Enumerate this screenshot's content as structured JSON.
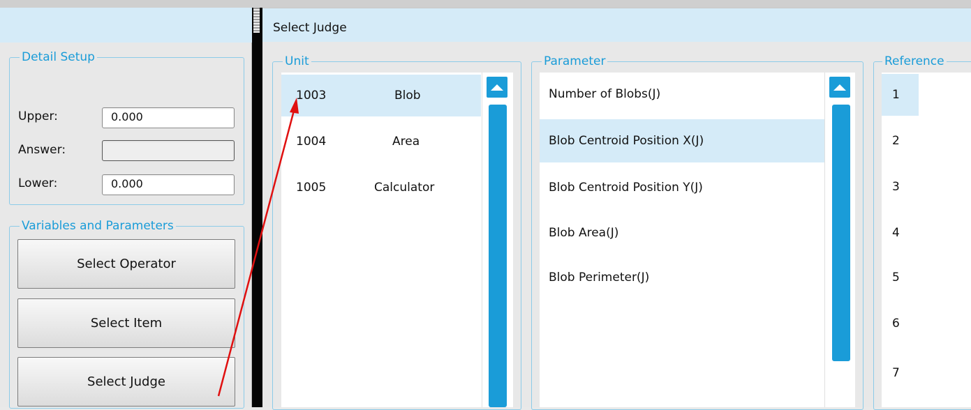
{
  "left_panel": {
    "detail_setup": {
      "title": "Detail Setup",
      "upper_label": "Upper:",
      "upper_value": "0.000",
      "answer_label": "Answer:",
      "answer_value": "",
      "lower_label": "Lower:",
      "lower_value": "0.000"
    },
    "variables": {
      "title": "Variables and Parameters",
      "select_operator": "Select Operator",
      "select_item": "Select Item",
      "select_judge": "Select Judge"
    }
  },
  "right_panel": {
    "title": "Select Judge",
    "unit": {
      "title": "Unit",
      "rows": [
        {
          "id": "1003",
          "name": "Blob",
          "selected": true
        },
        {
          "id": "1004",
          "name": "Area",
          "selected": false
        },
        {
          "id": "1005",
          "name": "Calculator",
          "selected": false
        }
      ]
    },
    "parameter": {
      "title": "Parameter",
      "rows": [
        {
          "label": "Number of Blobs(J)",
          "selected": false
        },
        {
          "label": "Blob Centroid Position X(J)",
          "selected": true
        },
        {
          "label": "Blob Centroid Position Y(J)",
          "selected": false
        },
        {
          "label": "Blob Area(J)",
          "selected": false
        },
        {
          "label": "Blob Perimeter(J)",
          "selected": false
        }
      ]
    },
    "reference": {
      "title": "Reference",
      "rows": [
        "1",
        "2",
        "3",
        "4",
        "5",
        "6",
        "7"
      ]
    }
  },
  "colors": {
    "accent": "#1a9cd8",
    "header_bg": "#d5ebf8",
    "annotation_arrow": "#e01010"
  },
  "icons": {
    "scroll_up": "triangle-up-icon",
    "annotation": "red-arrow"
  }
}
